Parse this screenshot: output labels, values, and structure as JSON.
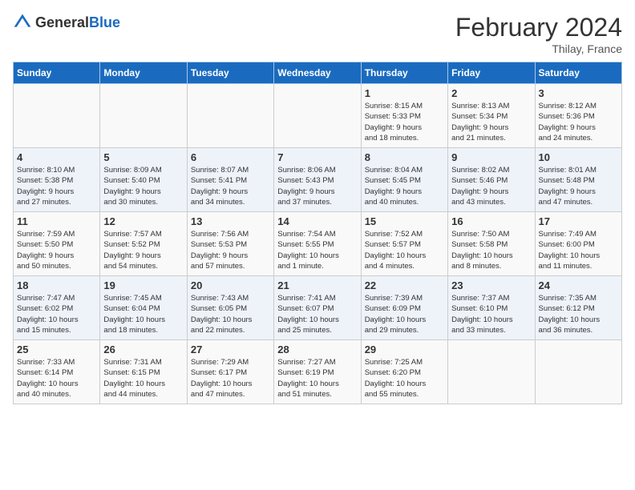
{
  "header": {
    "logo_general": "General",
    "logo_blue": "Blue",
    "title": "February 2024",
    "subtitle": "Thilay, France"
  },
  "days_of_week": [
    "Sunday",
    "Monday",
    "Tuesday",
    "Wednesday",
    "Thursday",
    "Friday",
    "Saturday"
  ],
  "weeks": [
    [
      {
        "day": "",
        "info": ""
      },
      {
        "day": "",
        "info": ""
      },
      {
        "day": "",
        "info": ""
      },
      {
        "day": "",
        "info": ""
      },
      {
        "day": "1",
        "info": "Sunrise: 8:15 AM\nSunset: 5:33 PM\nDaylight: 9 hours\nand 18 minutes."
      },
      {
        "day": "2",
        "info": "Sunrise: 8:13 AM\nSunset: 5:34 PM\nDaylight: 9 hours\nand 21 minutes."
      },
      {
        "day": "3",
        "info": "Sunrise: 8:12 AM\nSunset: 5:36 PM\nDaylight: 9 hours\nand 24 minutes."
      }
    ],
    [
      {
        "day": "4",
        "info": "Sunrise: 8:10 AM\nSunset: 5:38 PM\nDaylight: 9 hours\nand 27 minutes."
      },
      {
        "day": "5",
        "info": "Sunrise: 8:09 AM\nSunset: 5:40 PM\nDaylight: 9 hours\nand 30 minutes."
      },
      {
        "day": "6",
        "info": "Sunrise: 8:07 AM\nSunset: 5:41 PM\nDaylight: 9 hours\nand 34 minutes."
      },
      {
        "day": "7",
        "info": "Sunrise: 8:06 AM\nSunset: 5:43 PM\nDaylight: 9 hours\nand 37 minutes."
      },
      {
        "day": "8",
        "info": "Sunrise: 8:04 AM\nSunset: 5:45 PM\nDaylight: 9 hours\nand 40 minutes."
      },
      {
        "day": "9",
        "info": "Sunrise: 8:02 AM\nSunset: 5:46 PM\nDaylight: 9 hours\nand 43 minutes."
      },
      {
        "day": "10",
        "info": "Sunrise: 8:01 AM\nSunset: 5:48 PM\nDaylight: 9 hours\nand 47 minutes."
      }
    ],
    [
      {
        "day": "11",
        "info": "Sunrise: 7:59 AM\nSunset: 5:50 PM\nDaylight: 9 hours\nand 50 minutes."
      },
      {
        "day": "12",
        "info": "Sunrise: 7:57 AM\nSunset: 5:52 PM\nDaylight: 9 hours\nand 54 minutes."
      },
      {
        "day": "13",
        "info": "Sunrise: 7:56 AM\nSunset: 5:53 PM\nDaylight: 9 hours\nand 57 minutes."
      },
      {
        "day": "14",
        "info": "Sunrise: 7:54 AM\nSunset: 5:55 PM\nDaylight: 10 hours\nand 1 minute."
      },
      {
        "day": "15",
        "info": "Sunrise: 7:52 AM\nSunset: 5:57 PM\nDaylight: 10 hours\nand 4 minutes."
      },
      {
        "day": "16",
        "info": "Sunrise: 7:50 AM\nSunset: 5:58 PM\nDaylight: 10 hours\nand 8 minutes."
      },
      {
        "day": "17",
        "info": "Sunrise: 7:49 AM\nSunset: 6:00 PM\nDaylight: 10 hours\nand 11 minutes."
      }
    ],
    [
      {
        "day": "18",
        "info": "Sunrise: 7:47 AM\nSunset: 6:02 PM\nDaylight: 10 hours\nand 15 minutes."
      },
      {
        "day": "19",
        "info": "Sunrise: 7:45 AM\nSunset: 6:04 PM\nDaylight: 10 hours\nand 18 minutes."
      },
      {
        "day": "20",
        "info": "Sunrise: 7:43 AM\nSunset: 6:05 PM\nDaylight: 10 hours\nand 22 minutes."
      },
      {
        "day": "21",
        "info": "Sunrise: 7:41 AM\nSunset: 6:07 PM\nDaylight: 10 hours\nand 25 minutes."
      },
      {
        "day": "22",
        "info": "Sunrise: 7:39 AM\nSunset: 6:09 PM\nDaylight: 10 hours\nand 29 minutes."
      },
      {
        "day": "23",
        "info": "Sunrise: 7:37 AM\nSunset: 6:10 PM\nDaylight: 10 hours\nand 33 minutes."
      },
      {
        "day": "24",
        "info": "Sunrise: 7:35 AM\nSunset: 6:12 PM\nDaylight: 10 hours\nand 36 minutes."
      }
    ],
    [
      {
        "day": "25",
        "info": "Sunrise: 7:33 AM\nSunset: 6:14 PM\nDaylight: 10 hours\nand 40 minutes."
      },
      {
        "day": "26",
        "info": "Sunrise: 7:31 AM\nSunset: 6:15 PM\nDaylight: 10 hours\nand 44 minutes."
      },
      {
        "day": "27",
        "info": "Sunrise: 7:29 AM\nSunset: 6:17 PM\nDaylight: 10 hours\nand 47 minutes."
      },
      {
        "day": "28",
        "info": "Sunrise: 7:27 AM\nSunset: 6:19 PM\nDaylight: 10 hours\nand 51 minutes."
      },
      {
        "day": "29",
        "info": "Sunrise: 7:25 AM\nSunset: 6:20 PM\nDaylight: 10 hours\nand 55 minutes."
      },
      {
        "day": "",
        "info": ""
      },
      {
        "day": "",
        "info": ""
      }
    ]
  ]
}
